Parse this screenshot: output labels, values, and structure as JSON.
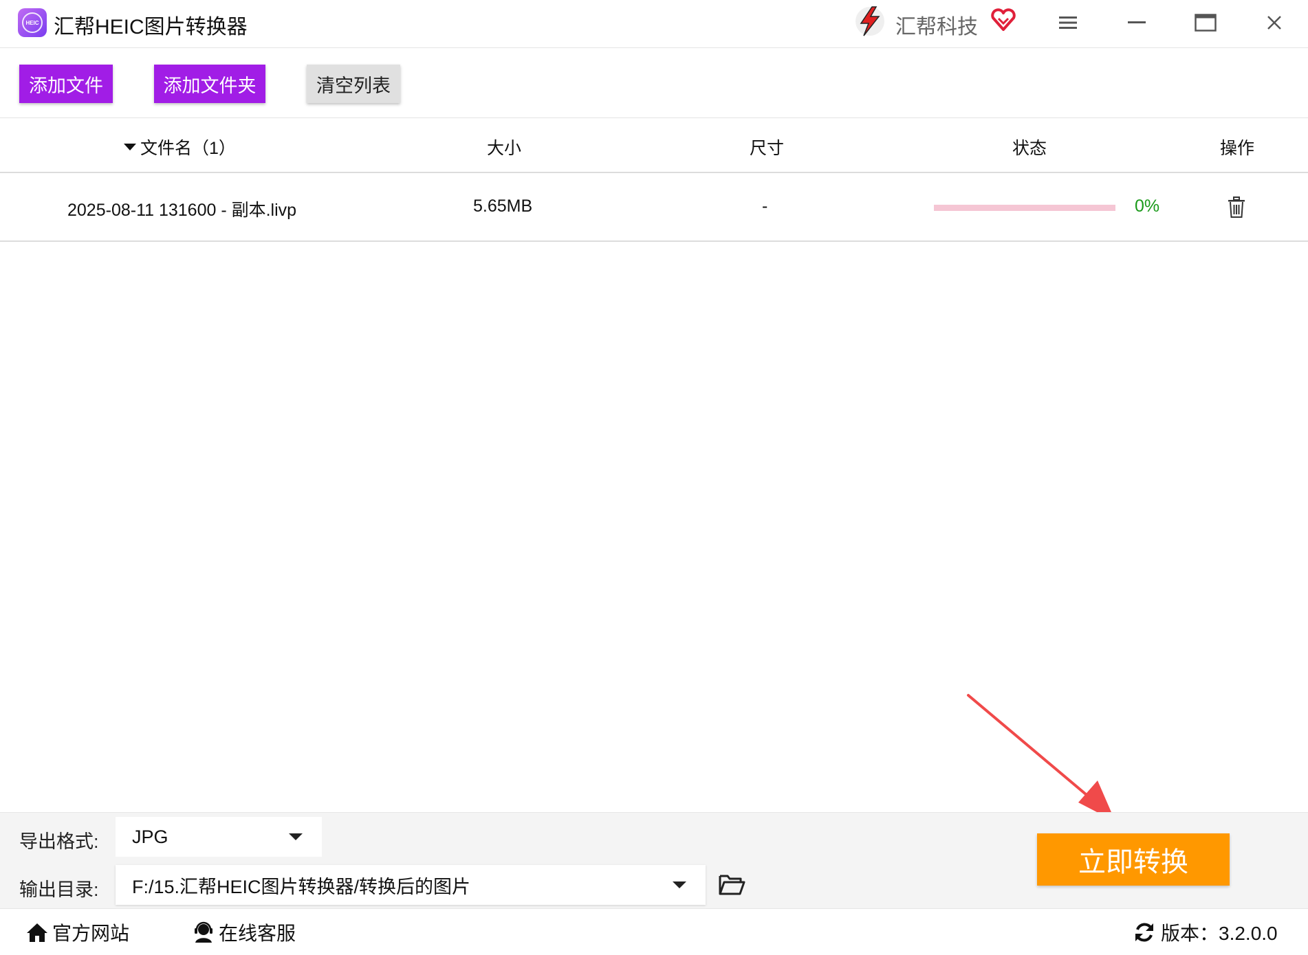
{
  "app": {
    "title": "汇帮HEIC图片转换器",
    "logo_text": "HEIC",
    "brand_name": "汇帮科技"
  },
  "toolbar": {
    "add_file": "添加文件",
    "add_folder": "添加文件夹",
    "clear_list": "清空列表"
  },
  "table": {
    "headers": {
      "name": "文件名（1）",
      "size": "大小",
      "dimension": "尺寸",
      "status": "状态",
      "action": "操作"
    },
    "rows": [
      {
        "name": "2025-08-11 131600 - 副本.livp",
        "size": "5.65MB",
        "dimension": "-",
        "progress": 0,
        "progress_text": "0%"
      }
    ]
  },
  "settings": {
    "format_label": "导出格式:",
    "format_value": "JPG",
    "dir_label": "输出目录:",
    "dir_value": "F:/15.汇帮HEIC图片转换器/转换后的图片",
    "convert_button": "立即转换"
  },
  "footer": {
    "website": "官方网站",
    "service": "在线客服",
    "version": "版本：3.2.0.0"
  },
  "colors": {
    "primary_purple": "#a11de6",
    "convert_orange": "#ff9800",
    "progress_track": "#f5c6d4",
    "percent_green": "#1a9a1a",
    "arrow_red": "#f04a4a"
  }
}
